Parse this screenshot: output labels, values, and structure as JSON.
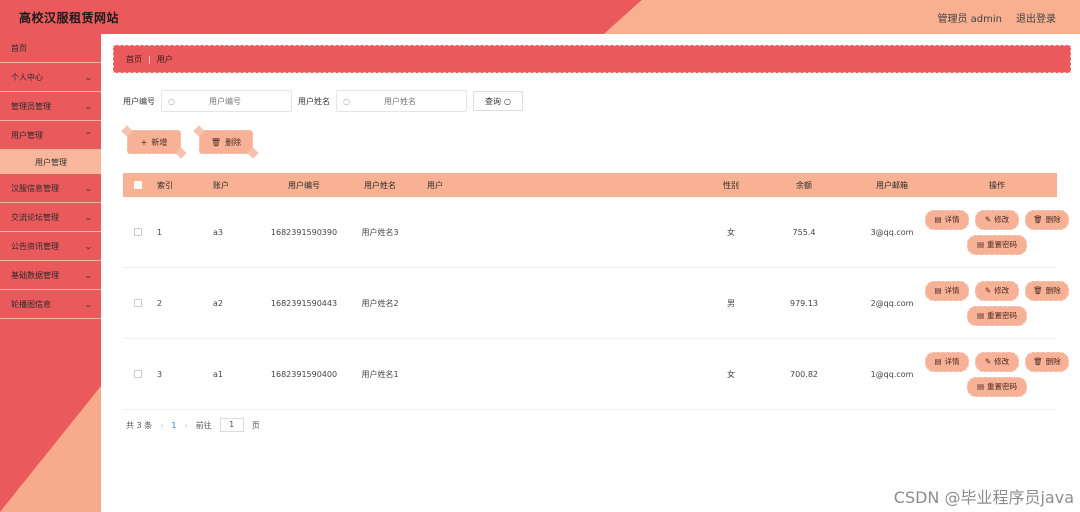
{
  "header": {
    "title": "高校汉服租赁网站",
    "admin": "管理员 admin",
    "logout": "退出登录"
  },
  "sidebar": {
    "items": [
      {
        "label": "首页",
        "chevron": false
      },
      {
        "label": "个人中心",
        "chevron": true
      },
      {
        "label": "管理员管理",
        "chevron": true
      },
      {
        "label": "用户管理",
        "chevron": true
      },
      {
        "label": "汉服信息管理",
        "chevron": true
      },
      {
        "label": "交流论坛管理",
        "chevron": true
      },
      {
        "label": "公告资讯管理",
        "chevron": true
      },
      {
        "label": "基础数据管理",
        "chevron": true
      },
      {
        "label": "轮播图信息",
        "chevron": true
      }
    ],
    "submenu": {
      "label": "用户管理"
    }
  },
  "breadcrumb": {
    "home": "首页",
    "current": "用户"
  },
  "search": {
    "label_no": "用户编号",
    "placeholder_no": "用户编号",
    "label_name": "用户姓名",
    "placeholder_name": "用户姓名",
    "button": "查询"
  },
  "actions": {
    "add": "新增",
    "delete": "删除"
  },
  "table": {
    "headers": {
      "index": "索引",
      "account": "账户",
      "user_no": "用户编号",
      "user_name": "用户姓名",
      "user": "用户",
      "sex": "性别",
      "balance": "余额",
      "email": "用户邮箱",
      "ops": "操作"
    },
    "rows": [
      {
        "index": "1",
        "account": "a3",
        "user_no": "1682391590390",
        "user_name": "用户姓名3",
        "sex": "女",
        "balance": "755.4",
        "email": "3@qq.com"
      },
      {
        "index": "2",
        "account": "a2",
        "user_no": "1682391590443",
        "user_name": "用户姓名2",
        "sex": "男",
        "balance": "979.13",
        "email": "2@qq.com"
      },
      {
        "index": "3",
        "account": "a1",
        "user_no": "1682391590400",
        "user_name": "用户姓名1",
        "sex": "女",
        "balance": "700.82",
        "email": "1@qq.com"
      }
    ],
    "row_ops": {
      "detail": "详情",
      "edit": "修改",
      "delete": "删除",
      "reset_pwd": "重置密码"
    }
  },
  "pagination": {
    "total": "共 3 条",
    "current": "1",
    "goto_label": "前往",
    "goto_value": "1",
    "page_unit": "页"
  },
  "watermark": "CSDN @毕业程序员java",
  "colors": {
    "accent": "#ea5a5c",
    "light": "#f8b192"
  }
}
